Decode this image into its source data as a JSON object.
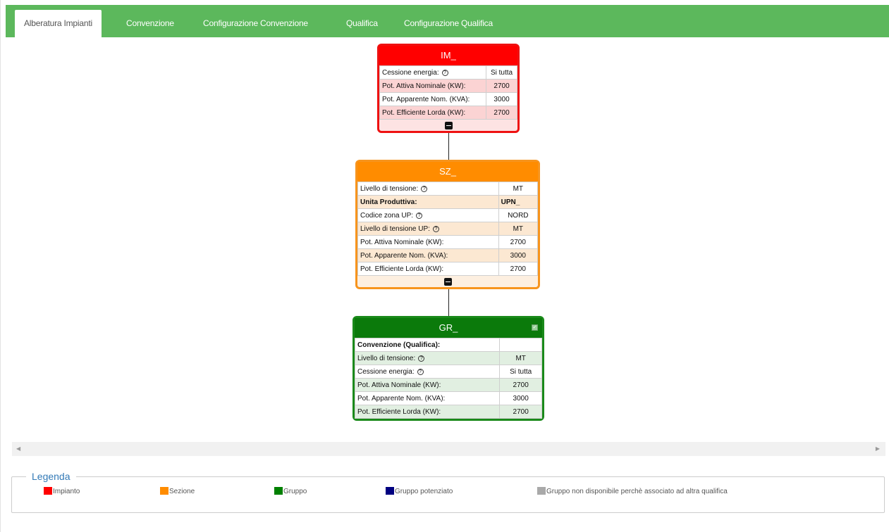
{
  "tabs": [
    {
      "label": "Alberatura Impianti",
      "active": true
    },
    {
      "label": "Convenzione",
      "active": false
    },
    {
      "label": "Configurazione Convenzione",
      "active": false
    },
    {
      "label": "Qualifica",
      "active": false
    },
    {
      "label": "Configurazione Qualifica",
      "active": false
    }
  ],
  "impianto": {
    "title": "IM_",
    "rows": [
      {
        "label": "Cessione energia:",
        "value": "Si tutta"
      },
      {
        "label": "Pot. Attiva Nominale (KW):",
        "value": "2700"
      },
      {
        "label": "Pot. Apparente Nom. (KVA):",
        "value": "3000"
      },
      {
        "label": "Pot. Efficiente Lorda (KW):",
        "value": "2700"
      }
    ]
  },
  "sezione": {
    "title": "SZ_",
    "rows": [
      {
        "label": "Livello di tensione:",
        "value": "MT"
      },
      {
        "label": "Unita Produttiva:",
        "value": "UPN_"
      },
      {
        "label": "Codice zona UP:",
        "value": "NORD"
      },
      {
        "label": "Livello di tensione UP:",
        "value": "MT"
      },
      {
        "label": "Pot. Attiva Nominale (KW):",
        "value": "2700"
      },
      {
        "label": "Pot. Apparente Nom. (KVA):",
        "value": "3000"
      },
      {
        "label": "Pot. Efficiente Lorda (KW):",
        "value": "2700"
      }
    ]
  },
  "gruppo": {
    "title": "GR_",
    "rows": [
      {
        "label": "Convenzione (Qualifica):",
        "value": ""
      },
      {
        "label": "Livello di tensione:",
        "value": "MT"
      },
      {
        "label": "Cessione energia:",
        "value": "Si tutta"
      },
      {
        "label": "Pot. Attiva Nominale (KW):",
        "value": "2700"
      },
      {
        "label": "Pot. Apparente Nom. (KVA):",
        "value": "3000"
      },
      {
        "label": "Pot. Efficiente Lorda (KW):",
        "value": "2700"
      }
    ]
  },
  "help_glyph": "?",
  "legend": {
    "title": "Legenda",
    "items": [
      {
        "label": "Impianto",
        "color": "#ff0000"
      },
      {
        "label": "Sezione",
        "color": "#ff8c00"
      },
      {
        "label": "Gruppo",
        "color": "#008000"
      },
      {
        "label": "Gruppo potenziato",
        "color": "#000080"
      },
      {
        "label": "Gruppo non disponibile perchè associato ad altra qualifica",
        "color": "#a9a9a9"
      }
    ]
  },
  "scroll": {
    "left_arrow": "◀",
    "right_arrow": "▶"
  }
}
